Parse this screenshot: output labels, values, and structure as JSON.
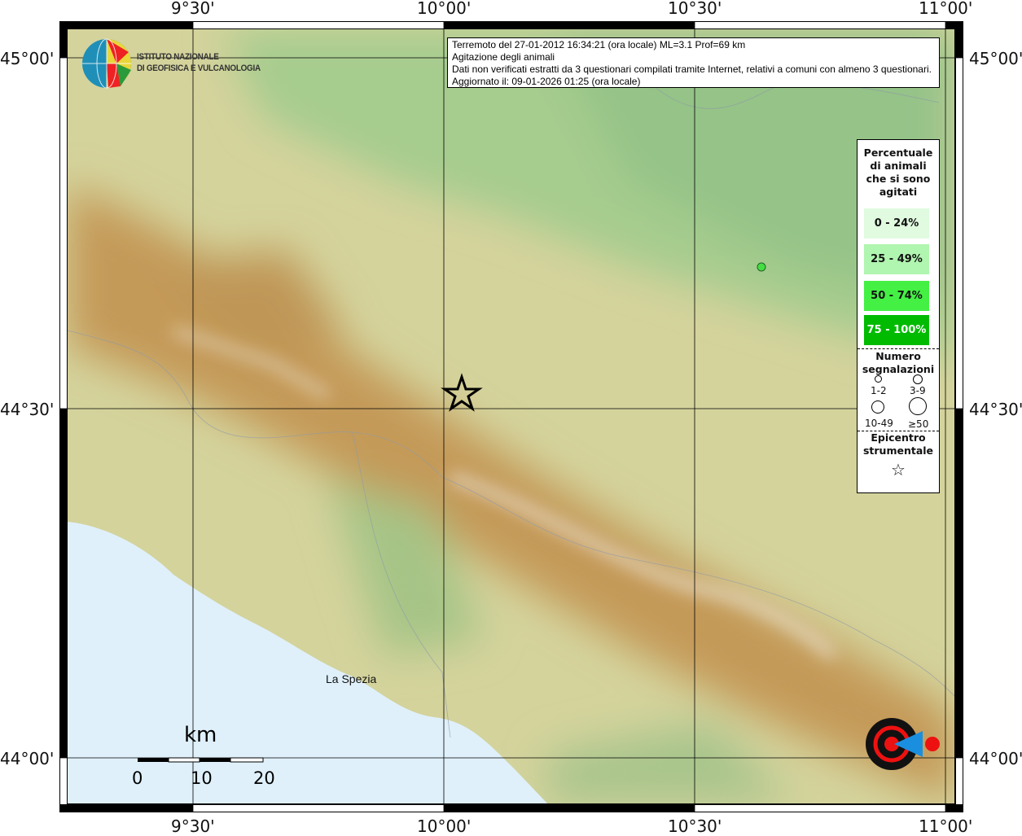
{
  "axes": {
    "top_labels": [
      "9°30'",
      "10°00'",
      "10°30'",
      "11°00'"
    ],
    "bottom_labels": [
      "9°30'",
      "10°00'",
      "10°30'",
      "11°00'"
    ],
    "left_labels": [
      "45°00'",
      "44°30'",
      "44°00'"
    ],
    "right_labels": [
      "45°00'",
      "44°30'",
      "44°00'"
    ]
  },
  "info": {
    "line1": "Terremoto del 27-01-2012 16:34:21 (ora locale) ML=3.1 Prof=69 km",
    "line2": "Agitazione degli animali",
    "line3": "Dati non verificati estratti da 3 questionari compilati tramite Internet, relativi a comuni con almeno 3 questionari.",
    "line4": "Aggiornato il: 09-01-2026 01:25 (ora locale)"
  },
  "logo_ingv": {
    "line1": "ISTITUTO NAZIONALE",
    "line2": "DI GEOFISICA E VULCANOLOGIA"
  },
  "logo_hst": "www.haisentitoilterremoto.it",
  "legend": {
    "title": "Percentuale di animali che si sono agitati",
    "classes": [
      {
        "label": "0 - 24%",
        "color": "#e0fbe0"
      },
      {
        "label": "25 - 49%",
        "color": "#b0f5b0"
      },
      {
        "label": "50 - 74%",
        "color": "#44f044"
      },
      {
        "label": "75 - 100%",
        "color": "#00bb00"
      }
    ],
    "count_title": "Numero segnalazioni",
    "counts": [
      "1-2",
      "3-9",
      "10-49",
      "≥50"
    ],
    "epicenter_title": "Epicentro strumentale"
  },
  "places": [
    {
      "name": "La Spezia"
    }
  ],
  "points": [
    {
      "percent_class": "50 - 74%",
      "count_class": "1-2",
      "color": "#44dd44"
    }
  ],
  "scale": {
    "unit": "km",
    "ticks": [
      "0",
      "10",
      "20"
    ]
  }
}
